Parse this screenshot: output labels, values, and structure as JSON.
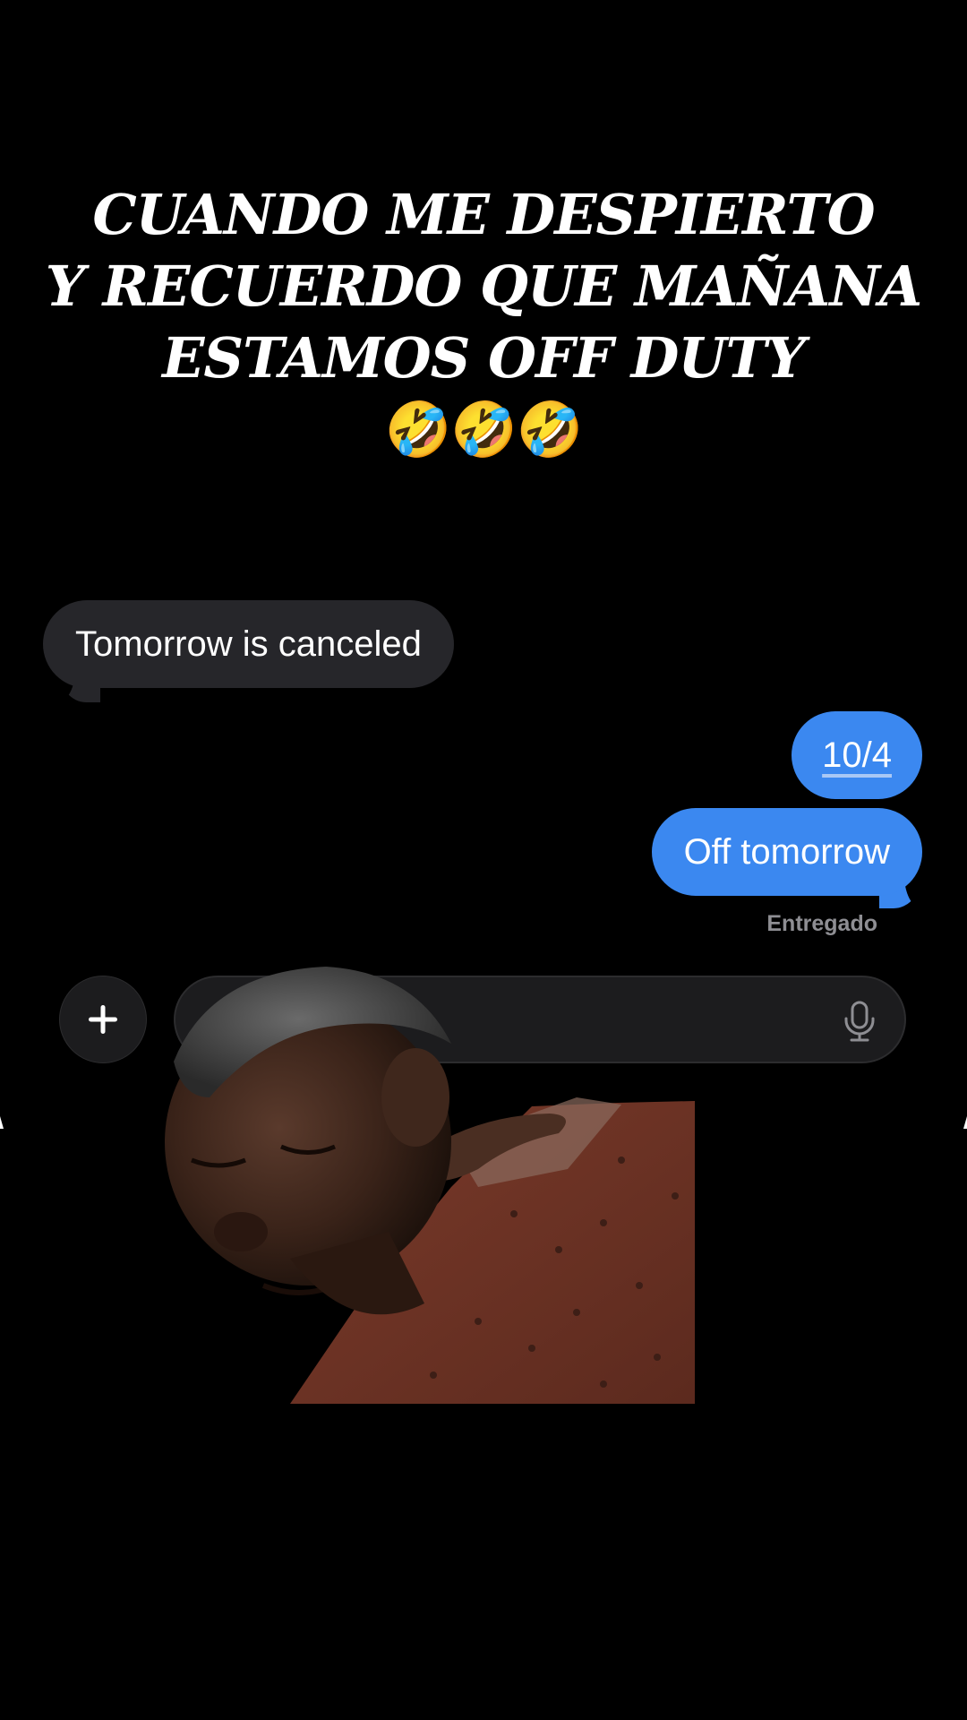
{
  "caption": {
    "lines": [
      "CUANDO ME DESPIERTO",
      "Y RECUERDO QUE MAÑANA",
      "ESTAMOS OFF DUTY"
    ],
    "emoji": "🤣🤣🤣"
  },
  "messages": {
    "incoming": "Tomorrow is canceled",
    "outgoing": [
      "10/4",
      "Off tomorrow"
    ],
    "status": "Entregado"
  },
  "composer": {
    "plus_icon": "plus-icon",
    "mic_icon": "microphone-icon"
  },
  "colors": {
    "background": "#000000",
    "incoming_bubble": "#26262a",
    "outgoing_bubble": "#3b88f0",
    "status_text": "#8e8e93"
  }
}
